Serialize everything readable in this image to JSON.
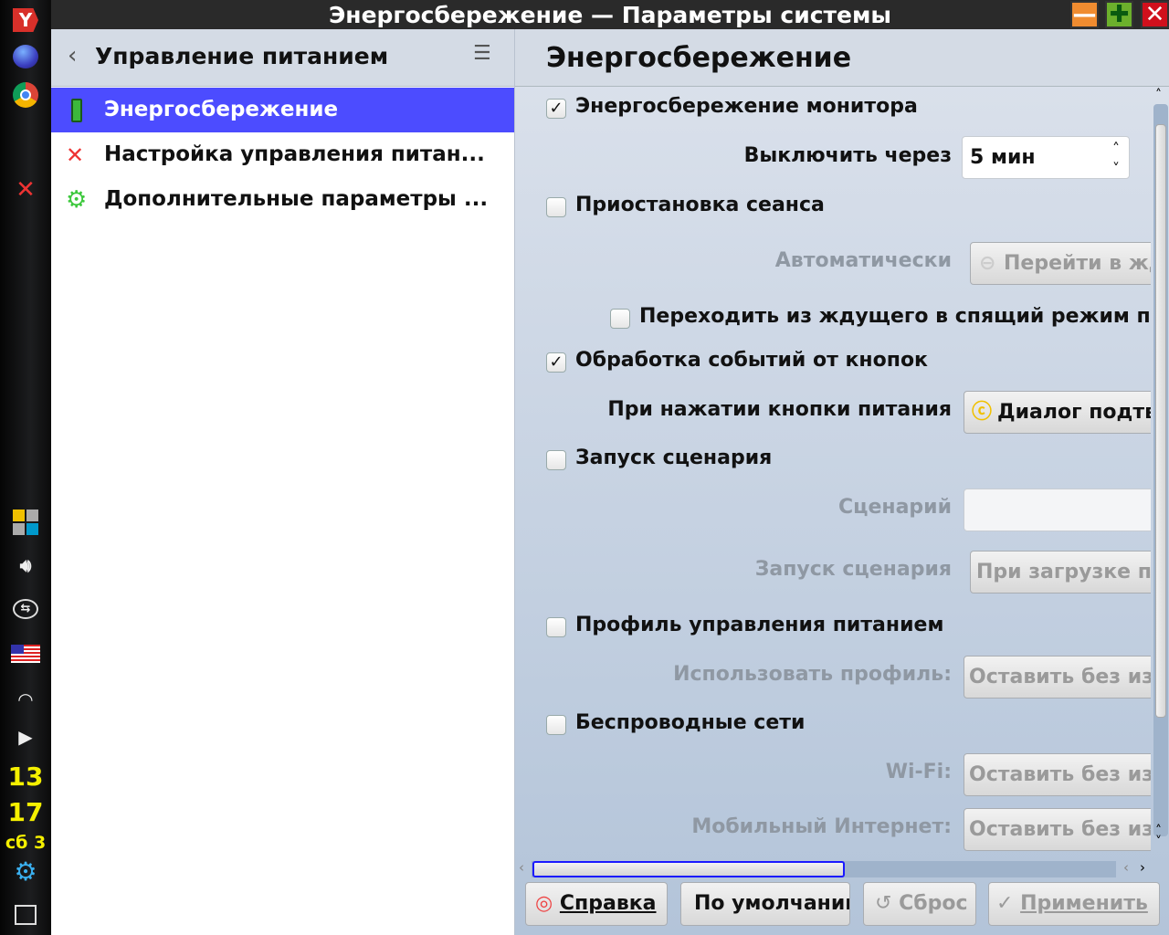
{
  "window": {
    "title": "Энергосбережение — Параметры системы"
  },
  "taskbar": {
    "clock_hour": "13",
    "clock_min": "17",
    "date": "сб 3",
    "icons": [
      "yandex-browser-icon",
      "firefox-icon",
      "chrome-icon",
      "system-settings-icon",
      "pager-icon",
      "volume-icon",
      "usb-icon",
      "us-flag-icon",
      "wifi-icon",
      "expand-arrow-icon",
      "kde-menu-icon",
      "show-desktop-icon"
    ]
  },
  "sidebar": {
    "title": "Управление питанием",
    "items": [
      {
        "label": "Энергосбережение",
        "icon": "battery-icon",
        "selected": true
      },
      {
        "label": "Настройка управления питан...",
        "icon": "tools-icon"
      },
      {
        "label": "Дополнительные параметры ...",
        "icon": "gear-icon"
      }
    ]
  },
  "colors": {
    "selection": "#4c4cff",
    "titlebar": "#2a2a2a"
  },
  "main": {
    "title": "Энергосбережение",
    "monitor": {
      "label": "Энергосбережение монитора",
      "checked": true,
      "off_label": "Выключить через",
      "off_value": "5 мин"
    },
    "suspend": {
      "label": "Приостановка сеанса",
      "checked": false,
      "auto_label": "Автоматически",
      "auto_value": "Перейти в жд",
      "hybrid_label": "Переходить из ждущего в спящий режим пр",
      "hybrid_checked": false
    },
    "buttons_events": {
      "label": "Обработка событий от кнопок",
      "checked": true,
      "power_label": "При нажатии кнопки питания",
      "power_value": "Диалог подтв"
    },
    "script": {
      "label": "Запуск сценария",
      "checked": false,
      "script_label": "Сценарий",
      "script_value": "",
      "run_label": "Запуск сценария",
      "run_value": "При загрузке пр"
    },
    "profile": {
      "label": "Профиль управления питанием",
      "checked": false,
      "use_label": "Использовать профиль:",
      "use_value": "Оставить без из"
    },
    "wireless": {
      "label": "Беспроводные сети",
      "checked": false,
      "wifi_label": "Wi-Fi:",
      "wifi_value": "Оставить без из",
      "mobile_label": "Мобильный Интернет:",
      "mobile_value": "Оставить без из"
    }
  },
  "footer": {
    "help": "Справка",
    "defaults": "По умолчанию",
    "reset": "Сброс",
    "apply": "Применить"
  }
}
